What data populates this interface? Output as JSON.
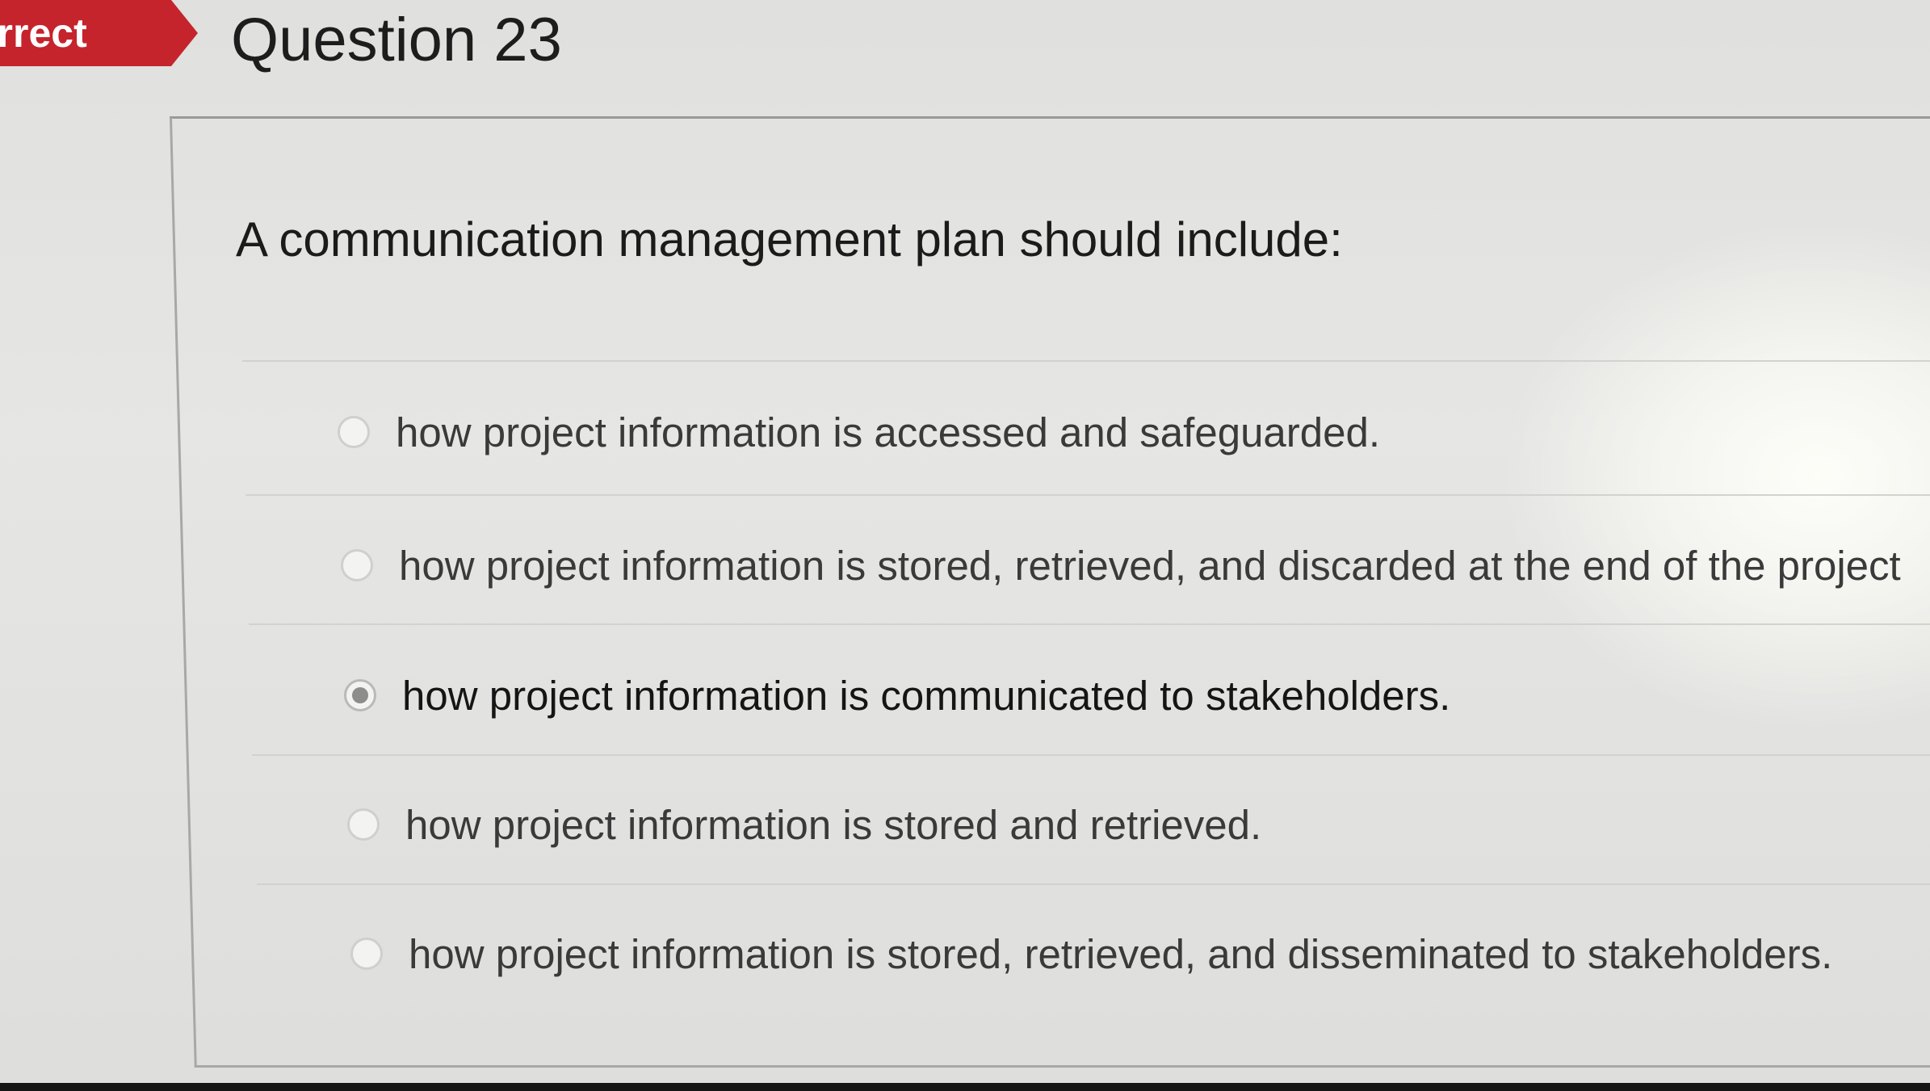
{
  "status_flag": {
    "label": "orrect",
    "color": "#c5242c"
  },
  "question": {
    "number_title": "Question 23",
    "prompt": "A communication management plan should include:"
  },
  "answers": [
    {
      "label": "how project information is accessed and safeguarded.",
      "selected": false
    },
    {
      "label": "how project information is stored, retrieved, and discarded at the end of the project",
      "selected": false
    },
    {
      "label": "how project information is communicated to stakeholders.",
      "selected": true
    },
    {
      "label": "how project information is stored and retrieved.",
      "selected": false
    },
    {
      "label": "how project information is stored, retrieved, and disseminated to stakeholders.",
      "selected": false
    }
  ]
}
